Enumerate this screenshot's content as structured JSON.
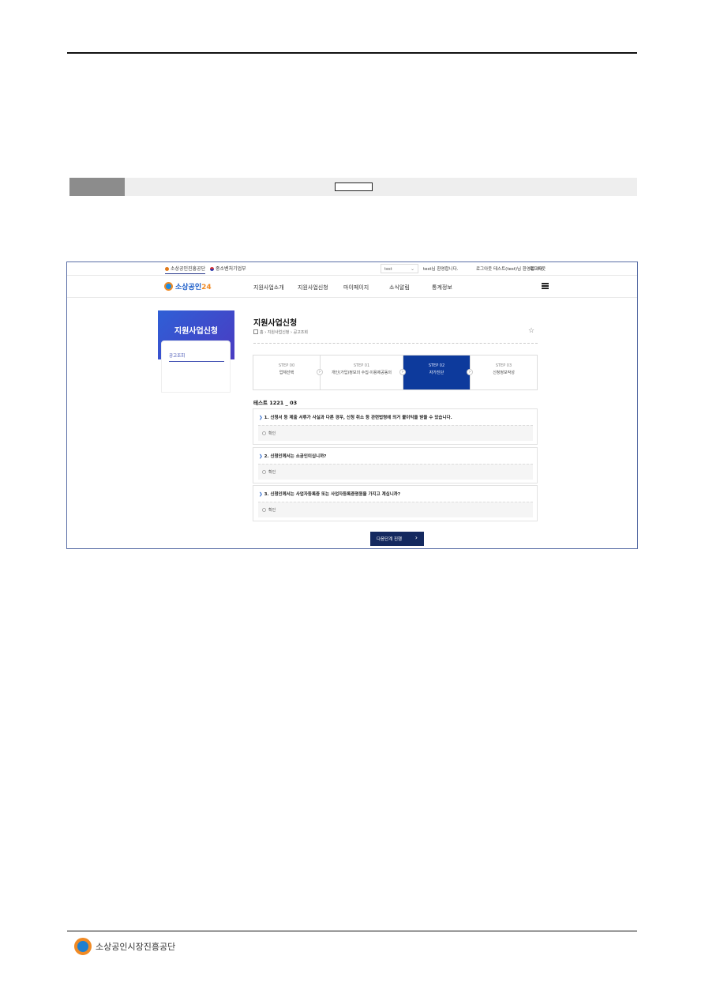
{
  "utility_bar": {
    "site_a": "소상공인진흥공단",
    "site_b": "중소벤처기업부",
    "select_value": "test",
    "user_1": "test님 환영합니다.",
    "user_2": "로그아웃 테스트(test)님 환영합니다.",
    "user_3": "로그아웃"
  },
  "header": {
    "logo_text": "소상공인",
    "logo_number": "24",
    "menu": [
      "지원사업소개",
      "지원사업신청",
      "마이페이지",
      "소식알림",
      "통계정보"
    ]
  },
  "sidebar": {
    "title": "지원사업신청",
    "item": "공고조회"
  },
  "page": {
    "title": "지원사업신청",
    "breadcrumb": [
      "홈",
      "지원사업신청",
      "공고조회"
    ]
  },
  "steps": [
    {
      "no": "STEP 00",
      "name": "업체선택"
    },
    {
      "no": "STEP 01",
      "name": "개인(가입)정보의 수집·이용제공동의"
    },
    {
      "no": "STEP 02",
      "name": "자가진단"
    },
    {
      "no": "STEP 03",
      "name": "신청정보작성"
    }
  ],
  "active_step": 2,
  "section_title": "테스트 1221 _ 03",
  "questions": [
    {
      "text": "1. 신청서 등 제출 서류가 사실과 다른 경우, 신청 취소 등 관련법령에 의거 불이익을 받을 수 있습니다.",
      "answer": "확인"
    },
    {
      "text": "2. 신청인께서는 소공인이십니까?",
      "answer": "확인"
    },
    {
      "text": "3. 신청인께서는 사업자등록증 또는 사업자등록증명원을 가지고 계십니까?",
      "answer": "확인"
    }
  ],
  "next_button": "다음단계 진행",
  "footer": {
    "org_name": "소상공인시장진흥공단"
  },
  "colors": {
    "accent": "#0d3a9c",
    "button": "#14295f",
    "logo_orange": "#f08a24"
  }
}
